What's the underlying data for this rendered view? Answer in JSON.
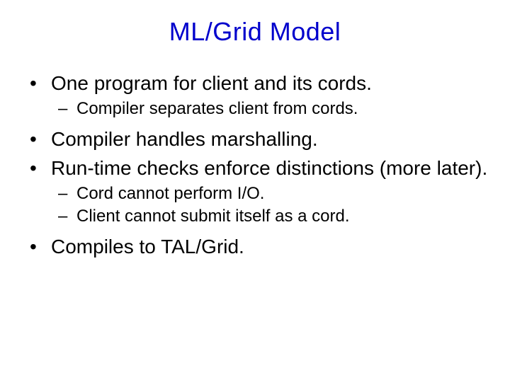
{
  "title": "ML/Grid Model",
  "bullets": {
    "b0": "One program for client and its cords.",
    "b0s": {
      "s0": "Compiler separates client from cords."
    },
    "b1": "Compiler handles marshalling.",
    "b2": "Run-time checks enforce distinctions (more later).",
    "b2s": {
      "s0": "Cord cannot perform I/O.",
      "s1": "Client cannot submit itself as a cord."
    },
    "b3": "Compiles to TAL/Grid."
  }
}
